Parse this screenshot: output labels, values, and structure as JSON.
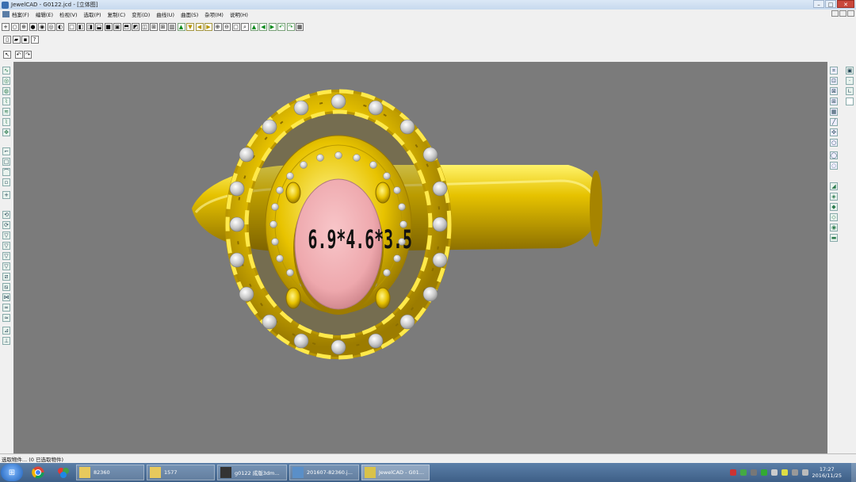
{
  "window": {
    "title": "JewelCAD - G0122.jcd - [立体图]"
  },
  "menu": {
    "items": [
      "档案(F)",
      "编辑(E)",
      "检视(V)",
      "选取(P)",
      "复制(C)",
      "变形(D)",
      "曲线(U)",
      "曲面(S)",
      "杂项(M)",
      "说明(H)"
    ]
  },
  "viewport": {
    "stone_label": "6.9*4.6*3.5"
  },
  "status": {
    "text": "选取物件... (0 已选取物件)"
  },
  "taskbar": {
    "tasks": [
      {
        "label": "82360"
      },
      {
        "label": "1577"
      },
      {
        "label": "g0122 成版3dm..."
      },
      {
        "label": "201607-82360.j..."
      },
      {
        "label": "JewelCAD - G01..."
      }
    ],
    "clock_time": "17:27",
    "clock_date": "2016/11/25"
  },
  "colors": {
    "metal": "#e6c200",
    "stone": "#eea8ad",
    "viewport_bg": "#7b7b7b",
    "diamond": "#c8c8c8"
  }
}
